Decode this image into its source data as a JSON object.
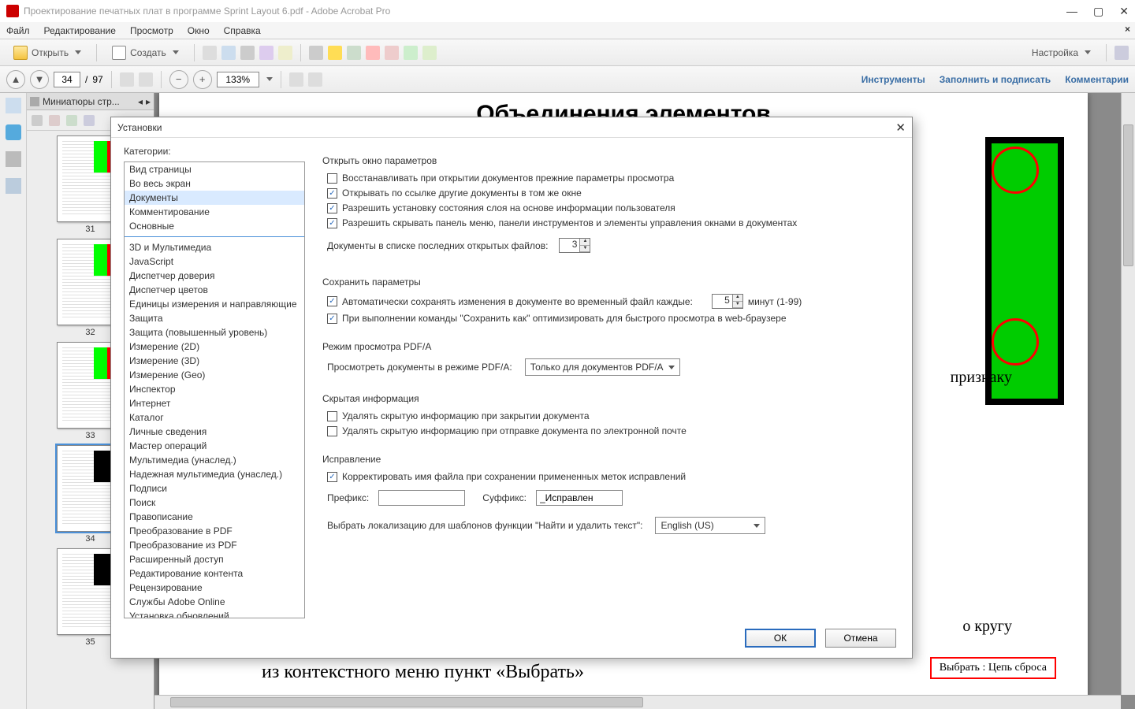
{
  "window": {
    "title": "Проектирование печатных плат в программе Sprint Layout 6.pdf - Adobe Acrobat Pro"
  },
  "menu": {
    "file": "Файл",
    "edit": "Редактирование",
    "view": "Просмотр",
    "window": "Окно",
    "help": "Справка"
  },
  "toolbar": {
    "open": "Открыть",
    "create": "Создать",
    "settings": "Настройка"
  },
  "nav": {
    "page": "34",
    "total": "97",
    "zoom": "133%"
  },
  "links": {
    "tools": "Инструменты",
    "fill": "Заполнить и подписать",
    "comments": "Комментарии"
  },
  "thumbs": {
    "title": "Миниатюры стр...",
    "nums": [
      "31",
      "32",
      "33",
      "34",
      "35"
    ]
  },
  "doc": {
    "heading": "Объединения элементов",
    "frag1": "признаку",
    "frag2": "о кругу",
    "frag3": "из контекстного меню пункт «Выбрать»",
    "frag4": "Выбрать : Цепь сброса"
  },
  "dialog": {
    "title": "Установки",
    "cat_label": "Категории:",
    "cats_a": [
      "Вид страницы",
      "Во весь экран",
      "Документы",
      "Комментирование",
      "Основные"
    ],
    "cats_b": [
      "3D и Мультимедиа",
      "JavaScript",
      "Диспетчер доверия",
      "Диспетчер цветов",
      "Единицы измерения и направляющие",
      "Защита",
      "Защита (повышенный уровень)",
      "Измерение (2D)",
      "Измерение (3D)",
      "Измерение (Geo)",
      "Инспектор",
      "Интернет",
      "Каталог",
      "Личные сведения",
      "Мастер операций",
      "Мультимедиа (унаслед.)",
      "Надежная мультимедиа (унаслед.)",
      "Подписи",
      "Поиск",
      "Правописание",
      "Преобразование в PDF",
      "Преобразование из PDF",
      "Расширенный доступ",
      "Редактирование контента",
      "Рецензирование",
      "Службы Adobe Online",
      "Установка обновлений"
    ],
    "sec_open": "Открыть окно параметров",
    "chk_restore": "Восстанавливать при открытии документов прежние параметры просмотра",
    "chk_samewin": "Открывать по ссылке другие документы в том же окне",
    "chk_layer": "Разрешить установку состояния слоя на основе информации пользователя",
    "chk_hidemenu": "Разрешить скрывать панель меню, панели инструментов и элементы управления окнами в документах",
    "recent_label": "Документы в списке последних открытых файлов:",
    "recent_val": "3",
    "sec_save": "Сохранить параметры",
    "chk_autosave": "Автоматически сохранять изменения в документе во временный файл каждые:",
    "autosave_val": "5",
    "autosave_unit": "минут (1-99)",
    "chk_fastweb": "При выполнении команды \"Сохранить как\" оптимизировать для быстрого просмотра в web-браузере",
    "sec_pdfa": "Режим просмотра PDF/A",
    "pdfa_label": "Просмотреть документы в режиме PDF/A:",
    "pdfa_val": "Только для документов PDF/A",
    "sec_hidden": "Скрытая информация",
    "chk_hid_close": "Удалять скрытую информацию при закрытии документа",
    "chk_hid_email": "Удалять скрытую информацию при отправке документа по электронной почте",
    "sec_fix": "Исправление",
    "chk_fixfn": "Корректировать имя файла при сохранении примененных меток исправлений",
    "prefix_label": "Префикс:",
    "prefix_val": "",
    "suffix_label": "Суффикс:",
    "suffix_val": "_Исправлен",
    "locale_label": "Выбрать локализацию для шаблонов функции \"Найти и удалить текст\":",
    "locale_val": "English (US)",
    "ok": "ОК",
    "cancel": "Отмена"
  }
}
